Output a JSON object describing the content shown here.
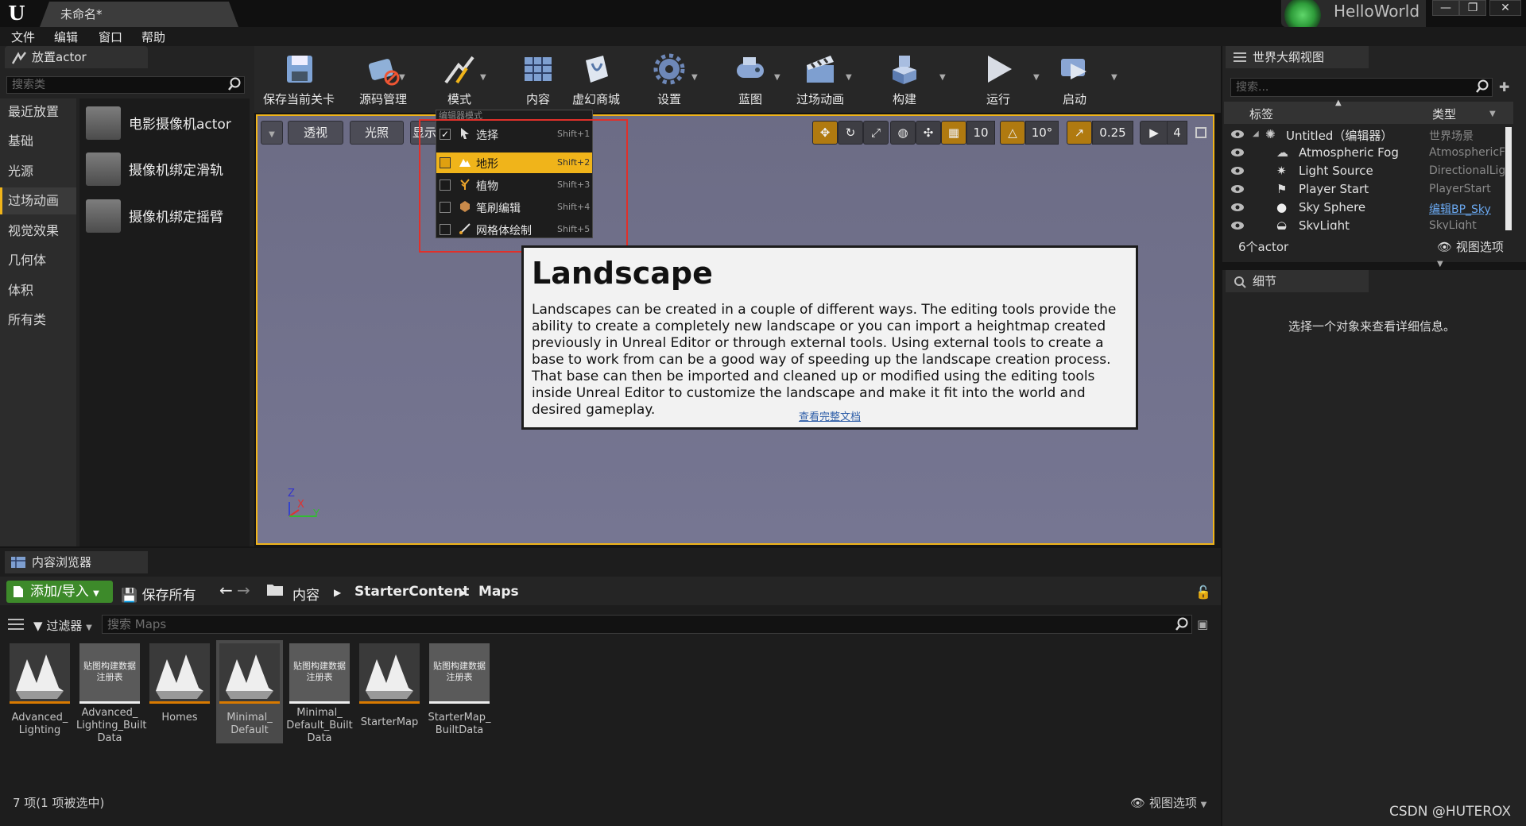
{
  "window": {
    "doc_title": "未命名*",
    "project_name": "HelloWorld",
    "controls": [
      "—",
      "❐",
      "✕"
    ]
  },
  "menu": [
    "文件",
    "编辑",
    "窗口",
    "帮助"
  ],
  "place_panel": {
    "tab_label": "放置actor",
    "search_placeholder": "搜索类",
    "categories": [
      "最近放置",
      "基础",
      "光源",
      "过场动画",
      "视觉效果",
      "几何体",
      "体积",
      "所有类"
    ],
    "active_category": "过场动画",
    "items": [
      "电影摄像机actor",
      "摄像机绑定滑轨",
      "摄像机绑定摇臂"
    ]
  },
  "toolbar": {
    "items": [
      "保存当前关卡",
      "源码管理",
      "模式",
      "内容",
      "虚幻商城",
      "设置",
      "蓝图",
      "过场动画",
      "构建",
      "运行",
      "启动"
    ]
  },
  "viewport": {
    "perspective": "透视",
    "lighting": "光照",
    "show": "显示",
    "grid_snap": "10",
    "rotation_snap": "10°",
    "scale_snap": "0.25",
    "camera_speed": "4",
    "axis_z": "Z",
    "axis_x": "X",
    "axis_y": "Y"
  },
  "mode_menu": {
    "title": "编辑器模式",
    "rows": [
      {
        "label": "选择",
        "key": "Shift+1",
        "checked": "✓"
      },
      {
        "label": "地形",
        "key": "Shift+2",
        "checked": ""
      },
      {
        "label": "植物",
        "key": "Shift+3",
        "checked": ""
      },
      {
        "label": "笔刷编辑",
        "key": "Shift+4",
        "checked": ""
      },
      {
        "label": "网格体绘制",
        "key": "Shift+5",
        "checked": ""
      }
    ],
    "highlighted": "地形"
  },
  "tooltip": {
    "title": "Landscape",
    "body": "Landscapes can be created in a couple of different ways. The editing tools provide the ability to create a completely new landscape or you can import a heightmap created previously in Unreal Editor or through external tools. Using external tools to create a base to work from can be a good way of speeding up the landscape creation process. That base can then be imported and cleaned up or modified using the editing tools inside Unreal Editor to customize the landscape and make it fit into the world and desired gameplay.",
    "link": "查看完整文档"
  },
  "outliner": {
    "tab_label": "世界大纲视图",
    "search_placeholder": "搜索...",
    "col_label": "标签",
    "col_type": "类型",
    "rows": [
      {
        "name": "Untitled（编辑器）",
        "type": "世界场景"
      },
      {
        "name": "Atmospheric Fog",
        "type": "AtmosphericF"
      },
      {
        "name": "Light Source",
        "type": "DirectionalLig"
      },
      {
        "name": "Player Start",
        "type": "PlayerStart"
      },
      {
        "name": "Sky Sphere",
        "type": "编辑BP_Sky"
      },
      {
        "name": "SkyLight",
        "type": "SkyLight"
      }
    ],
    "actor_count": "6个actor",
    "view_options": "视图选项"
  },
  "details": {
    "tab_label": "细节",
    "empty_text": "选择一个对象来查看详细信息。"
  },
  "content_browser": {
    "tab_label": "内容浏览器",
    "add_import": "添加/导入",
    "save_all": "保存所有",
    "path": [
      "内容",
      "StarterContent",
      "Maps"
    ],
    "filters": "过滤器",
    "search_placeholder": "搜索 Maps",
    "reg_thumb_text": "贴图构建数据注册表",
    "assets": [
      {
        "label": "Advanced_ Lighting",
        "kind": "map"
      },
      {
        "label": "Advanced_ Lighting_Built Data",
        "kind": "reg"
      },
      {
        "label": "Homes",
        "kind": "map"
      },
      {
        "label": "Minimal_ Default",
        "kind": "map"
      },
      {
        "label": "Minimal_ Default_Built Data",
        "kind": "reg"
      },
      {
        "label": "StarterMap",
        "kind": "map"
      },
      {
        "label": "StarterMap_ BuiltData",
        "kind": "reg"
      }
    ],
    "selected_asset": "Minimal_ Default",
    "status": "7 项(1 项被选中)",
    "view_options": "视图选项"
  },
  "watermark": "CSDN @HUTEROX",
  "colors": {
    "accent": "#f0b41a",
    "red_highlight": "#e0302a",
    "add_button": "#3d8a2a"
  }
}
